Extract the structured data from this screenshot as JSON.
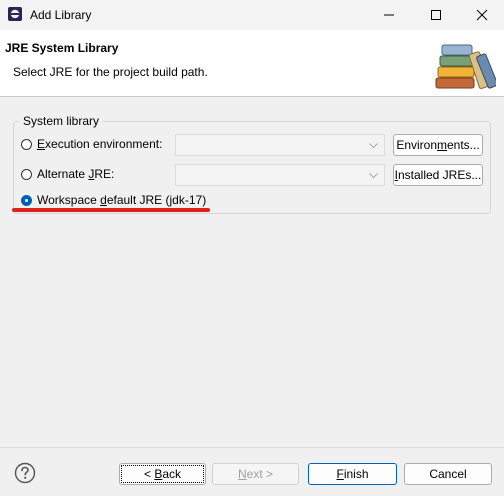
{
  "window": {
    "title": "Add Library"
  },
  "header": {
    "title": "JRE System Library",
    "description": "Select JRE for the project build path."
  },
  "group": {
    "label": "System library",
    "options": [
      {
        "label_u": "E",
        "label_rest": "xecution environment:",
        "selected": false,
        "button_pre": "Environ",
        "button_u": "m",
        "button_post": "ents...",
        "value": ""
      },
      {
        "label_pre": "Alternate ",
        "label_u": "J",
        "label_rest": "RE:",
        "selected": false,
        "button_pre": "",
        "button_u": "I",
        "button_post": "nstalled JREs...",
        "value": ""
      },
      {
        "label_pre": "Workspace ",
        "label_u": "d",
        "label_rest": "efault JRE (jdk-17)",
        "selected": true
      }
    ]
  },
  "footer": {
    "back_pre": "< ",
    "back_u": "B",
    "back_post": "ack",
    "next_u": "N",
    "next_post": "ext >",
    "finish_u": "F",
    "finish_post": "inish",
    "cancel": "Cancel"
  },
  "colors": {
    "accent": "#005fb8",
    "annotation_underline": "#e0201d"
  }
}
